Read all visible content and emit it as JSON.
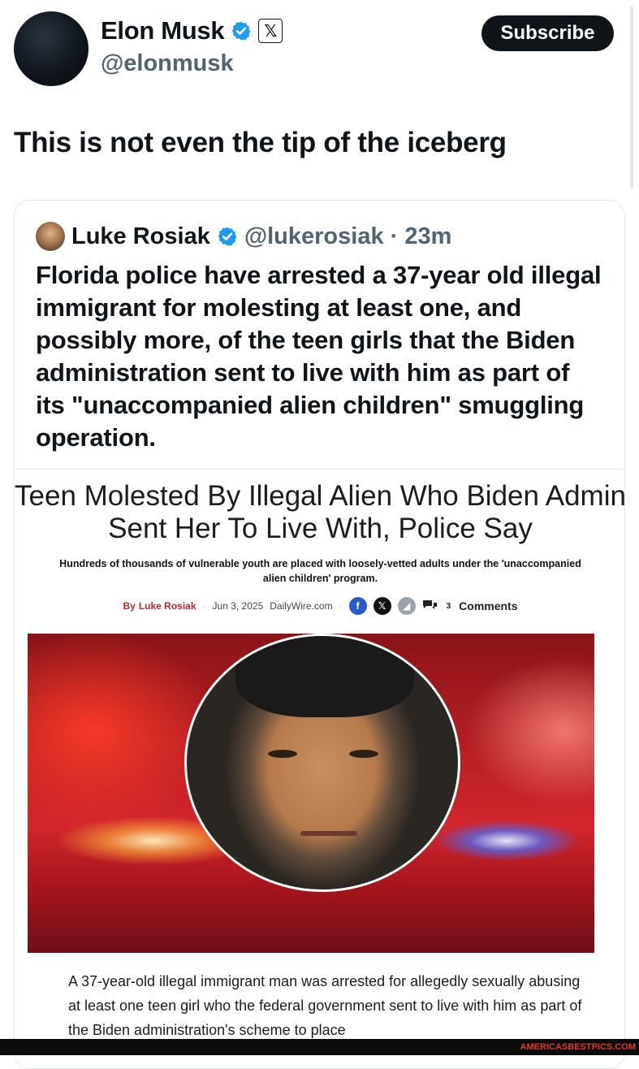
{
  "author": {
    "name": "Elon Musk",
    "handle": "@elonmusk",
    "x_icon": "𝕏"
  },
  "subscribe_label": "Subscribe",
  "post_text": "This is not even the tip of the iceberg",
  "quote": {
    "name": "Luke Rosiak",
    "handle_time": "@lukerosiak · 23m",
    "text": "Florida police have arrested a 37-year old illegal immigrant for molesting at least one, and possibly more, of the teen girls that the Biden administration sent to live with him as part of its \"unaccompanied alien children\" smuggling operation."
  },
  "article": {
    "title": "Teen Molested By Illegal Alien Who Biden Admin Sent Her To Live With, Police Say",
    "subtitle": "Hundreds of thousands of vulnerable youth are placed with loosely-vetted adults under the 'unaccompanied alien children' program.",
    "byline_prefix": "By",
    "author": "Luke Rosiak",
    "date": "Jun 3, 2025",
    "source": "DailyWire.com",
    "fb_icon": "f",
    "x_icon": "𝕏",
    "telegram_icon": "◢",
    "comment_count": "3",
    "comments_label": "Comments",
    "body": "A 37-year-old illegal immigrant man was arrested for allegedly sexually abusing at least one teen girl who the federal government sent to live with him as part of the Biden administration's scheme to place"
  },
  "watermark": "AMERICASBESTPICS.COM",
  "colors": {
    "verified": "#1d9bf0",
    "author_red": "#b9282d",
    "watermark": "#e0382e"
  }
}
